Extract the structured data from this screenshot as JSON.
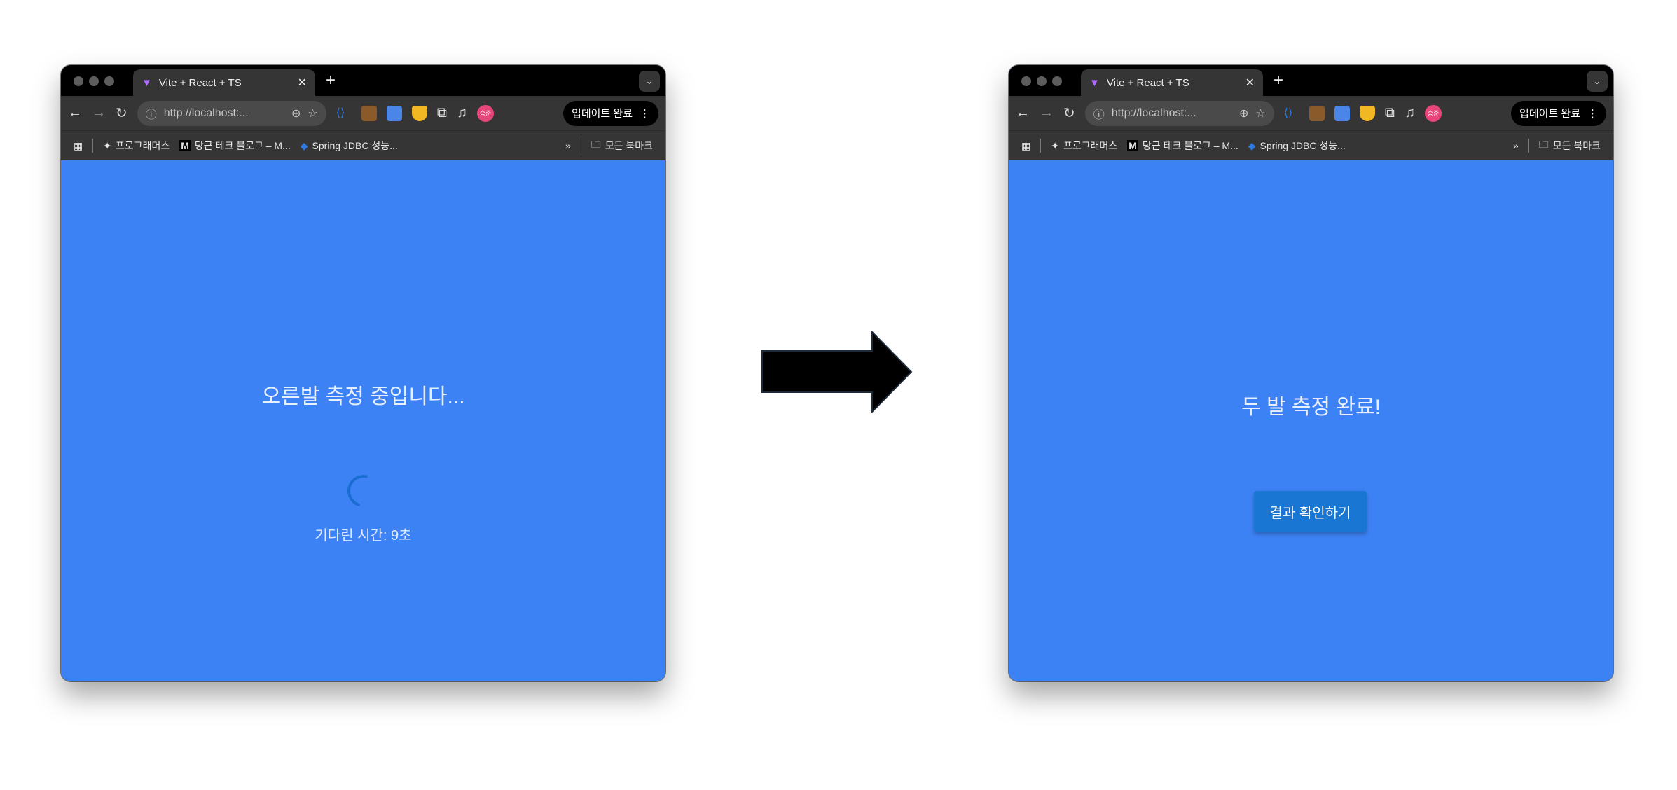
{
  "browser": {
    "tab_title": "Vite + React + TS",
    "url": "http://localhost:...",
    "update_label": "업데이트 완료",
    "avatar_text": "승준",
    "bookmarks": [
      "프로그래머스",
      "당근 테크 블로그 – M...",
      "Spring JDBC 성능..."
    ],
    "all_bookmarks": "모든 북마크",
    "overflow": "»"
  },
  "before": {
    "title": "오른발 측정 중입니다...",
    "wait_text": "기다린 시간: 9초"
  },
  "after": {
    "title": "두 발 측정 완료!",
    "button_label": "결과 확인하기"
  },
  "colors": {
    "page_bg": "#3d82f5",
    "button": "#1976d2",
    "spinner": "#1a6dd0"
  }
}
